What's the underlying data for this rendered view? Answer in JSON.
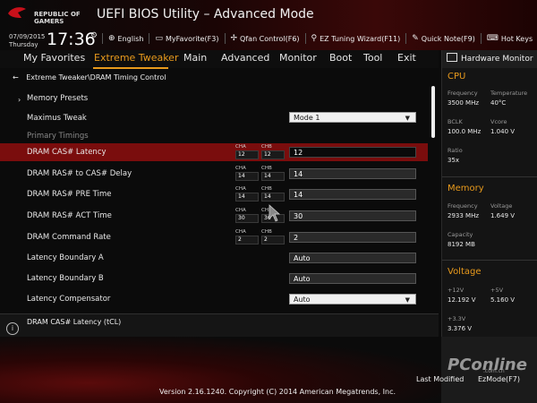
{
  "brand": {
    "line1": "REPUBLIC OF",
    "line2": "GAMERS"
  },
  "header": {
    "title": "UEFI BIOS Utility – Advanced Mode",
    "date": "07/09/2015",
    "day": "Thursday",
    "time": "17:36",
    "toolbar": [
      {
        "icon": "globe-icon",
        "label": "English"
      },
      {
        "icon": "star-monitor-icon",
        "label": "MyFavorite(F3)"
      },
      {
        "icon": "fan-icon",
        "label": "Qfan Control(F6)"
      },
      {
        "icon": "wand-icon",
        "label": "EZ Tuning Wizard(F11)"
      },
      {
        "icon": "note-icon",
        "label": "Quick Note(F9)"
      },
      {
        "icon": "keyboard-icon",
        "label": "Hot Keys"
      }
    ]
  },
  "menu": [
    "My Favorites",
    "Extreme Tweaker",
    "Main",
    "Advanced",
    "Monitor",
    "Boot",
    "Tool",
    "Exit"
  ],
  "active_menu": "Extreme Tweaker",
  "breadcrumb": "Extreme Tweaker\\DRAM Timing Control",
  "rows": {
    "memory_presets": "Memory Presets",
    "maximus_tweak": {
      "label": "Maximus Tweak",
      "value": "Mode 1"
    },
    "primary_timings": "Primary Timings",
    "cas": {
      "label": "DRAM CAS# Latency",
      "cha": "12",
      "chb": "12",
      "value": "12"
    },
    "ras_cas": {
      "label": "DRAM RAS# to CAS# Delay",
      "cha": "14",
      "chb": "14",
      "value": "14"
    },
    "ras_pre": {
      "label": "DRAM RAS# PRE Time",
      "cha": "14",
      "chb": "14",
      "value": "14"
    },
    "ras_act": {
      "label": "DRAM RAS# ACT Time",
      "cha": "30",
      "chb": "36",
      "value": "30"
    },
    "cmd_rate": {
      "label": "DRAM Command Rate",
      "cha": "2",
      "chb": "2",
      "value": "2"
    },
    "lat_a": {
      "label": "Latency Boundary A",
      "value": "Auto"
    },
    "lat_b": {
      "label": "Latency Boundary B",
      "value": "Auto"
    },
    "lat_comp": {
      "label": "Latency Compensator",
      "value": "Auto"
    }
  },
  "channel_labels": {
    "a": "CHA",
    "b": "CHB"
  },
  "help_text": "DRAM CAS# Latency (tCL)",
  "hardware_monitor": {
    "title": "Hardware Monitor",
    "cpu": {
      "heading": "CPU",
      "frequency_label": "Frequency",
      "frequency": "3500 MHz",
      "temperature_label": "Temperature",
      "temperature": "40°C",
      "bclk_label": "BCLK",
      "bclk": "100.0 MHz",
      "vcore_label": "Vcore",
      "vcore": "1.040 V",
      "ratio_label": "Ratio",
      "ratio": "35x"
    },
    "memory": {
      "heading": "Memory",
      "frequency_label": "Frequency",
      "frequency": "2933 MHz",
      "voltage_label": "Voltage",
      "voltage": "1.649 V",
      "capacity_label": "Capacity",
      "capacity": "8192 MB"
    },
    "voltage": {
      "heading": "Voltage",
      "v12_label": "+12V",
      "v12": "12.192 V",
      "v5_label": "+5V",
      "v5": "5.160 V",
      "v33_label": "+3.3V",
      "v33": "3.376 V"
    }
  },
  "footer": {
    "version": "Version 2.16.1240. Copyright (C) 2014 American Megatrends, Inc.",
    "last_modified": "Last Modified",
    "ez_mode": "EzMode(F7)"
  },
  "watermark": {
    "main": "PConline",
    "sub": ".com.cn"
  },
  "colors": {
    "accent": "#e89a1c",
    "selection": "#7a0d0d",
    "background": "#0b0b0b"
  }
}
